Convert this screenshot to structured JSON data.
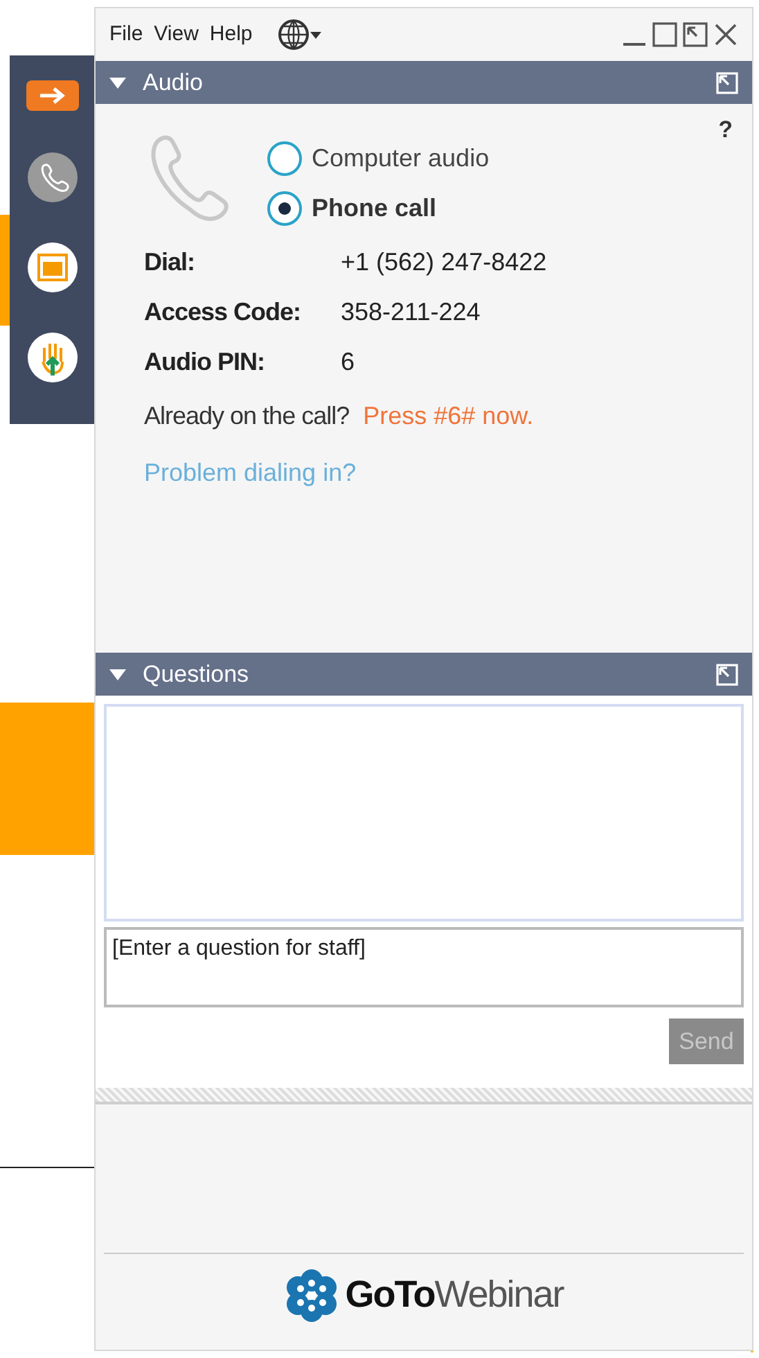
{
  "menu": [
    "File",
    "View",
    "Help"
  ],
  "audio_panel": {
    "title": "Audio",
    "expanded": true,
    "help": "?",
    "options": [
      {
        "label": "Computer audio",
        "selected": false
      },
      {
        "label": "Phone call",
        "selected": true
      }
    ],
    "details": [
      {
        "label": "Dial:",
        "value": "+1 (562) 247-8422"
      },
      {
        "label": "Access Code:",
        "value": "358-211-224"
      },
      {
        "label": "Audio PIN:",
        "value": "6"
      }
    ],
    "already_prompt": "Already on the call?",
    "already_action": "Press #6# now.",
    "problem_link": "Problem dialing in?"
  },
  "questions_panel": {
    "title": "Questions",
    "expanded": true,
    "input_placeholder": "[Enter a question for staff]",
    "send_button": {
      "label": "Send",
      "disabled": true
    }
  },
  "logo": "**GoTo**Webinar"
}
